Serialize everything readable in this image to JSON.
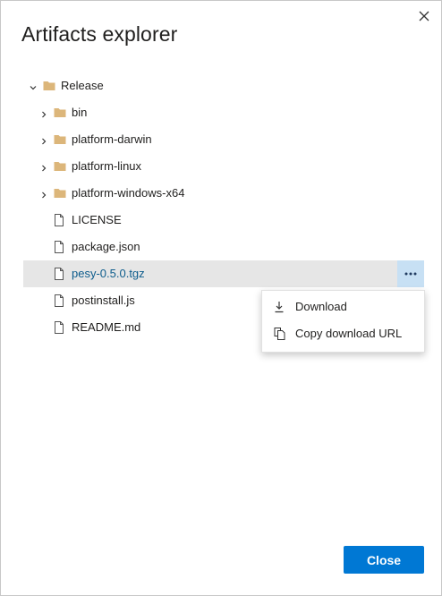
{
  "dialog": {
    "title": "Artifacts explorer",
    "close_icon": "close-icon",
    "close_button_label": "Close"
  },
  "tree": {
    "root": {
      "label": "Release",
      "expanded": true,
      "icon": "folder-icon"
    },
    "folders": [
      {
        "label": "bin",
        "expanded": false,
        "icon": "folder-icon"
      },
      {
        "label": "platform-darwin",
        "expanded": false,
        "icon": "folder-icon"
      },
      {
        "label": "platform-linux",
        "expanded": false,
        "icon": "folder-icon"
      },
      {
        "label": "platform-windows-x64",
        "expanded": false,
        "icon": "folder-icon"
      }
    ],
    "files": [
      {
        "label": "LICENSE",
        "icon": "file-icon",
        "selected": false
      },
      {
        "label": "package.json",
        "icon": "file-icon",
        "selected": false
      },
      {
        "label": "pesy-0.5.0.tgz",
        "icon": "file-icon",
        "selected": true
      },
      {
        "label": "postinstall.js",
        "icon": "file-icon",
        "selected": false
      },
      {
        "label": "README.md",
        "icon": "file-icon",
        "selected": false
      }
    ]
  },
  "context_menu": {
    "items": [
      {
        "label": "Download",
        "icon": "download-icon"
      },
      {
        "label": "Copy download URL",
        "icon": "copy-icon"
      }
    ]
  },
  "colors": {
    "accent": "#0078d4",
    "folder": "#dcb67a",
    "selected_row": "#e6e6e6",
    "selected_text": "#0d5c8c",
    "more_button": "#c7e0f4"
  }
}
